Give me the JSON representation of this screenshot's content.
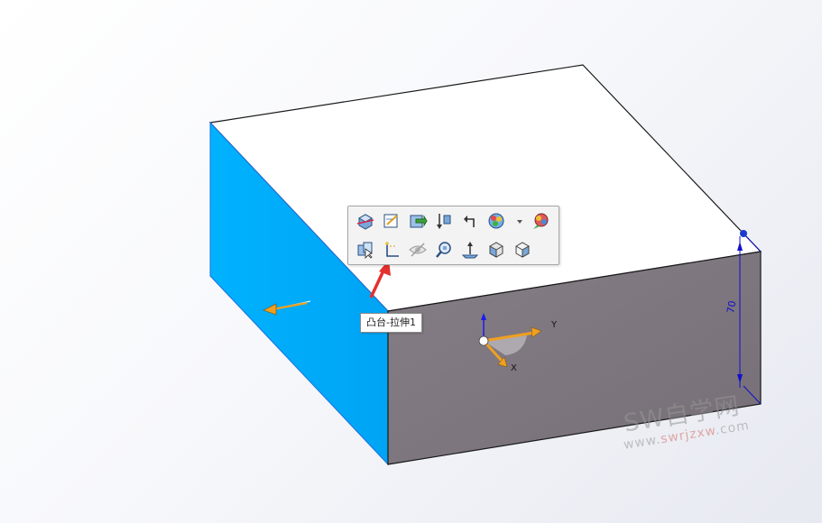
{
  "toolbar": {
    "row1": [
      "section-view",
      "edit-sketch",
      "edit-feature",
      "rollback",
      "parent-child",
      "appearance",
      "appearance-dropdown",
      "edit-appearance"
    ],
    "row2": [
      "select-other",
      "sketch",
      "hide",
      "zoom-to-selection",
      "normal-to",
      "view-orientation",
      "view-3d"
    ]
  },
  "tooltip": {
    "text": "凸台-拉伸1"
  },
  "triad": {
    "y_label": "Y",
    "x_label": "X"
  },
  "dimension": {
    "value": "70"
  },
  "watermark": {
    "brand": "SW自学网",
    "url_prefix": "www.",
    "url_accent": "swrjzxw",
    "url_suffix": ".com"
  },
  "colors": {
    "selected_face": "#00adff",
    "front_face": "#7f787f",
    "top_face": "#ffffff",
    "arrow": "#f0a020",
    "pointer": "#e53030",
    "dimension": "#1010cc"
  }
}
